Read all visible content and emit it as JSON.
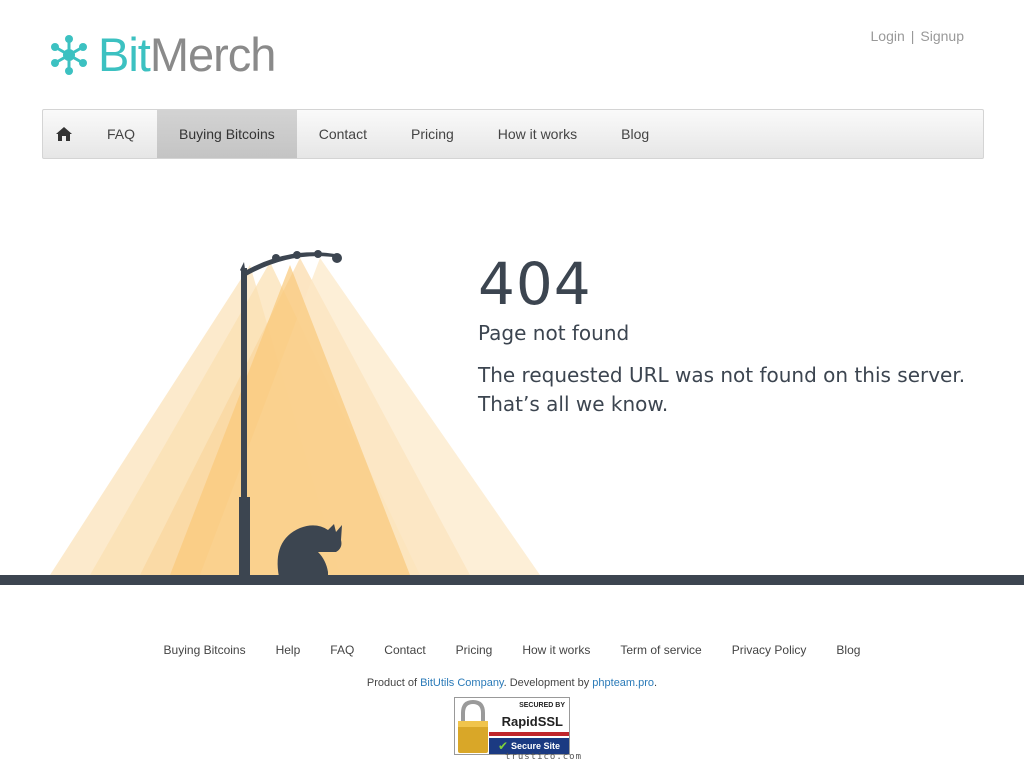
{
  "brand": {
    "name_part1": "Bit",
    "name_part2": "Merch",
    "accent": "#3cc1c1",
    "gray": "#8a8a8a"
  },
  "auth": {
    "login": "Login",
    "separator": "|",
    "signup": "Signup"
  },
  "nav": {
    "home_icon": "home-icon",
    "items": [
      {
        "label": "FAQ",
        "active": false
      },
      {
        "label": "Buying Bitcoins",
        "active": true
      },
      {
        "label": "Contact",
        "active": false
      },
      {
        "label": "Pricing",
        "active": false
      },
      {
        "label": "How it works",
        "active": false
      },
      {
        "label": "Blog",
        "active": false
      }
    ]
  },
  "error": {
    "code": "404",
    "title": "Page not found",
    "message": "The requested URL was not found on this server. That’s all we know."
  },
  "footer": {
    "links": [
      "Buying Bitcoins",
      "Help",
      "FAQ",
      "Contact",
      "Pricing",
      "How it works",
      "Term of service",
      "Privacy Policy",
      "Blog"
    ],
    "credits": {
      "prefix": "Product of ",
      "company": "BitUtils Company",
      "middle": ". Development by ",
      "dev": "phpteam.pro",
      "suffix": "."
    },
    "ssl": {
      "top": "SECURED BY",
      "brand": "RapidSSL",
      "badge": "Secure Site",
      "url": "trustico.com"
    }
  },
  "colors": {
    "dark": "#3c4550",
    "light": "#f9c97a",
    "link": "#2a7ab8"
  }
}
